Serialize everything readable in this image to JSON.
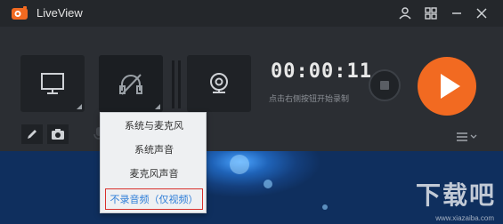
{
  "app": {
    "title": "LiveView",
    "accent": "#f26a21"
  },
  "titlebar": {
    "icons": [
      "user-icon",
      "grid-icon",
      "minimize-icon",
      "close-icon"
    ]
  },
  "sources": [
    {
      "name": "screen-capture",
      "icon": "monitor-icon"
    },
    {
      "name": "audio-source",
      "icon": "audio-off-icon"
    },
    {
      "name": "webcam",
      "icon": "webcam-icon"
    }
  ],
  "recording": {
    "timer": "00:00:11",
    "hint": "点击右侧按钮开始录制"
  },
  "tools": {
    "edit_icon": "pencil-icon",
    "screenshot_icon": "camera-icon",
    "mic_icon": "mic-icon",
    "menu_icon": "menu-icon"
  },
  "audio_menu": {
    "items": [
      "系统与麦克风",
      "系统声音",
      "麦克风声音",
      "不录音频（仅视频）"
    ],
    "selected_index": 3
  },
  "watermark": {
    "main": "下载吧",
    "sub": "www.xiazaiba.com"
  }
}
